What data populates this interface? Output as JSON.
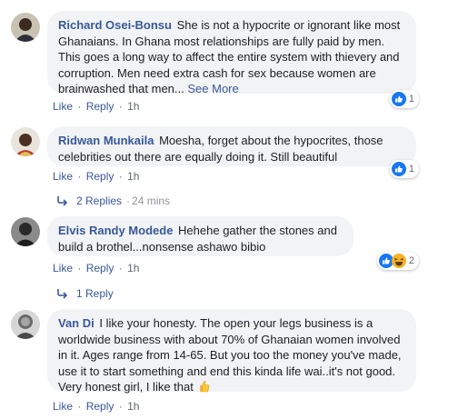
{
  "comments": [
    {
      "author": "Richard Osei-Bonsu",
      "text": "She is not a hypocrite or ignorant like most Ghanaians. In Ghana most relationships are fully paid by men. This goes a long way to affect the entire system with thievery and corruption. Men need extra cash for sex because women are brainwashed that men...",
      "see_more": "See More",
      "like": "Like",
      "reply": "Reply",
      "time": "1h",
      "reaction_count": "1",
      "reaction_icons": [
        "like-icon"
      ]
    },
    {
      "author": "Ridwan Munkaila",
      "text": "Moesha, forget about the hypocrites, those celebrities out there are equally doing it. Still beautiful",
      "like": "Like",
      "reply": "Reply",
      "time": "1h",
      "reaction_count": "1",
      "reaction_icons": [
        "like-icon"
      ],
      "replies": "2 Replies",
      "replies_time": "24 mins"
    },
    {
      "author": "Elvis Randy Modede",
      "text": "Hehehe gather the stones and build a brothel...nonsense ashawo bibio",
      "like": "Like",
      "reply": "Reply",
      "time": "1h",
      "reaction_count": "2",
      "reaction_icons": [
        "like-icon",
        "haha-icon"
      ],
      "replies": "1 Reply"
    },
    {
      "author": "Van Di",
      "text": "I like your honesty. The open your legs business is a worldwide business with about 70% of Ghanaian women involved in it. Ages range from 14-65. But you too the money you've made, use it to start something and end this kinda life wai..it's not good. Very honest girl, I like that",
      "like": "Like",
      "reply": "Reply",
      "time": "1h"
    }
  ],
  "separator": "·",
  "colors": {
    "link": "#385898",
    "bubble": "#f2f3f5",
    "meta": "#606770",
    "like_blue": "#1877f2",
    "haha_yellow": "#f7b125"
  }
}
